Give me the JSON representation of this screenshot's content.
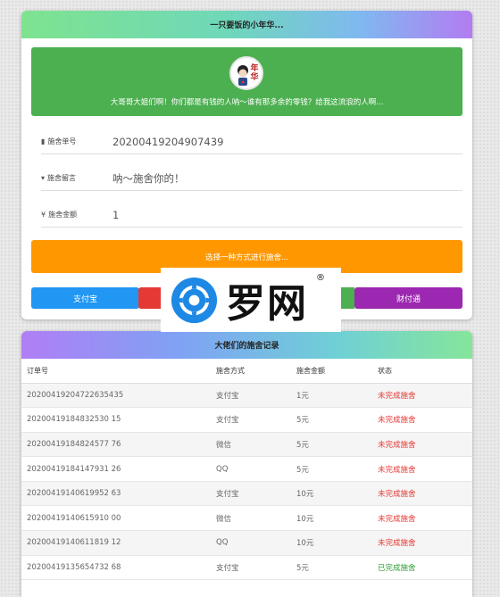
{
  "top_card": {
    "header_title": "一只要饭的小年华...",
    "banner_text": "大哥哥大姐们啊！你们都是有钱的人呐～谁有那多余的零钱？给我这流浪的人啊...",
    "avatar_text": "年华",
    "fields": [
      {
        "icon": "▮",
        "label": "施舍单号",
        "value": "20200419204907439"
      },
      {
        "icon": "▾",
        "label": "施舍留言",
        "value": "呐～施舍你的！"
      },
      {
        "icon": "¥",
        "label": "施舍金额",
        "value": "1"
      }
    ],
    "submit_label": "选择一种方式进行施舍...",
    "pay_buttons": {
      "alipay": "支付宝",
      "tenpay": "财付通"
    }
  },
  "watermark": {
    "text": "罗网",
    "reg_mark": "®"
  },
  "records": {
    "header_title": "大佬们的施舍记录",
    "columns": [
      "订单号",
      "施舍方式",
      "施舍金额",
      "状态"
    ],
    "rows": [
      {
        "order": "20200419204722635435",
        "method": "支付宝",
        "amount": "1元",
        "status": "未完成施舍",
        "status_type": "red"
      },
      {
        "order": "20200419184832530 15",
        "method": "支付宝",
        "amount": "5元",
        "status": "未完成施舍",
        "status_type": "red"
      },
      {
        "order": "20200419184824577 76",
        "method": "微信",
        "amount": "5元",
        "status": "未完成施舍",
        "status_type": "red"
      },
      {
        "order": "20200419184147931 26",
        "method": "QQ",
        "amount": "5元",
        "status": "未完成施舍",
        "status_type": "red"
      },
      {
        "order": "20200419140619952 63",
        "method": "支付宝",
        "amount": "10元",
        "status": "未完成施舍",
        "status_type": "red"
      },
      {
        "order": "20200419140615910 00",
        "method": "微信",
        "amount": "10元",
        "status": "未完成施舍",
        "status_type": "red"
      },
      {
        "order": "20200419140611819 12",
        "method": "QQ",
        "amount": "10元",
        "status": "未完成施舍",
        "status_type": "red"
      },
      {
        "order": "20200419135654732 68",
        "method": "支付宝",
        "amount": "5元",
        "status": "已完成施舍",
        "status_type": "green"
      }
    ]
  },
  "colors": {
    "banner": "#4caf50",
    "submit": "#ff9800",
    "alipay": "#2196f3",
    "wechat": "#e53935",
    "qq": "#4caf50",
    "tenpay": "#9c27b0",
    "status_red": "#e53935",
    "status_green": "#2e9d36"
  }
}
